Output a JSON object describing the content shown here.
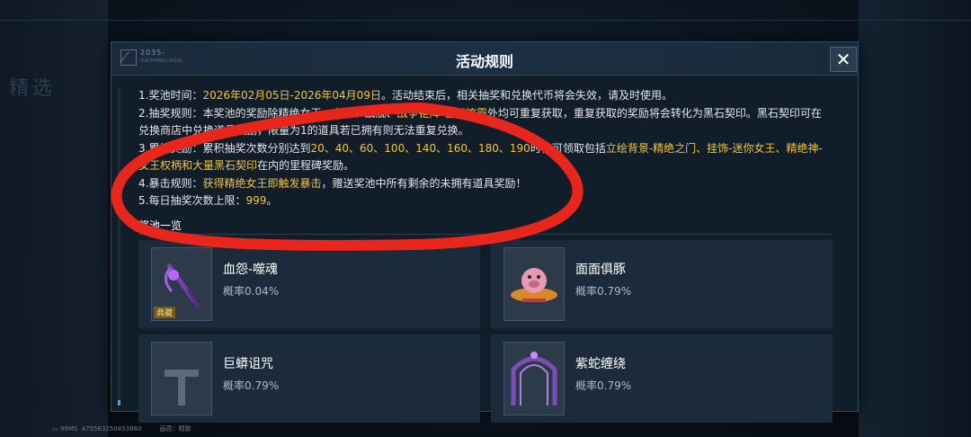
{
  "background": {
    "side_text": "精选"
  },
  "panel": {
    "logo_text": "2035-",
    "logo_sub": "SOUTHERN CROSS",
    "title": "活动规则",
    "close_label": "✕"
  },
  "rules": [
    {
      "num": "1.",
      "label": "奖池时间：",
      "hl1": "2026年02月05日-2026年04月09日",
      "text": "。活动结束后，相关抽奖和兑换代币将会失效，请及时使用。"
    },
    {
      "num": "2.",
      "label": "抽奖规则：",
      "text": "本奖池的奖励除精绝女王、皇冠、战舰、",
      "hl1": "战争钜阵-暮天流霞",
      "text2": "外均可重复获取，重复获取的奖励将会转化为黑石契印。黑石契印可在兑换商店中兑换道具奖励，限量为1的道具若已拥有则无法重复兑换。"
    },
    {
      "num": "3.",
      "label": "累计奖励：",
      "text": "累积抽奖次数分别达到",
      "hl1": "20、40、60、100、140、160、180、190",
      "text2": "时，可领取包括",
      "hl2": "立绘背景-精绝之门、挂饰-迷你女王、精绝神-女王权柄和大量黑石契印",
      "text3": "在内的里程碑奖励。"
    },
    {
      "num": "4.",
      "label": "暴击规则：",
      "hl1": "获得精绝女王即触发暴击",
      "text": "，赠送奖池中所有剩余的未拥有道具奖励！"
    },
    {
      "num": "5.",
      "label": "每日抽奖次数上限：",
      "hl1": "999",
      "text": "。"
    }
  ],
  "pool": {
    "title": "奖池一览",
    "items": [
      {
        "name": "血怨-噬魂",
        "rate": "概率0.04%",
        "tag": "典藏"
      },
      {
        "name": "面面俱豚",
        "rate": "概率0.79%"
      },
      {
        "name": "巨蟒诅咒",
        "rate": "概率0.79%"
      },
      {
        "name": "紫蛇缠绕",
        "rate": "概率0.79%"
      }
    ]
  },
  "footer": {
    "ping": "99MS",
    "uid": "475563250453860",
    "quality_label": "画质：",
    "quality": "精致"
  },
  "annotation_color": "#e8261c"
}
